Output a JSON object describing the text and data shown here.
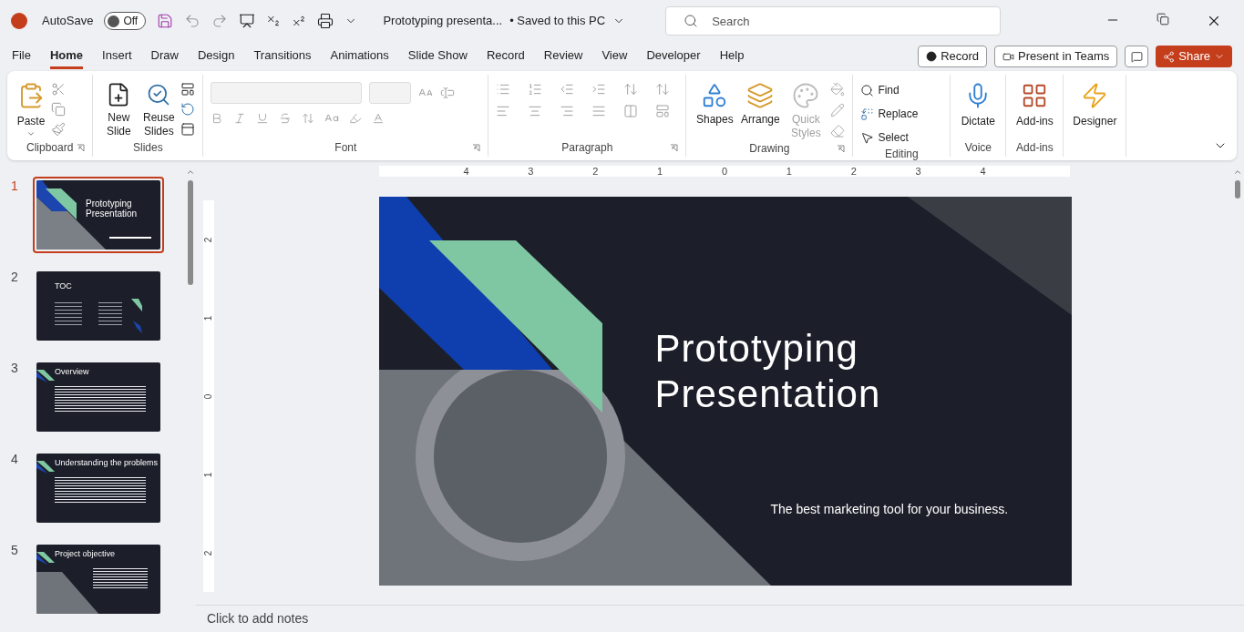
{
  "titlebar": {
    "autosave_label": "AutoSave",
    "autosave_on": false,
    "autosave_state": "Off",
    "file_title": "Prototyping presenta...",
    "save_status": "• Saved to this PC",
    "search_placeholder": "Search"
  },
  "tabs": [
    {
      "label": "File",
      "selected": false
    },
    {
      "label": "Home",
      "selected": true
    },
    {
      "label": "Insert",
      "selected": false
    },
    {
      "label": "Draw",
      "selected": false
    },
    {
      "label": "Design",
      "selected": false
    },
    {
      "label": "Transitions",
      "selected": false
    },
    {
      "label": "Animations",
      "selected": false
    },
    {
      "label": "Slide Show",
      "selected": false
    },
    {
      "label": "Record",
      "selected": false
    },
    {
      "label": "Review",
      "selected": false
    },
    {
      "label": "View",
      "selected": false
    },
    {
      "label": "Developer",
      "selected": false
    },
    {
      "label": "Help",
      "selected": false
    }
  ],
  "actions": {
    "record": "Record",
    "present": "Present in Teams",
    "share": "Share"
  },
  "ribbon": {
    "clipboard": {
      "label": "Clipboard",
      "paste": "Paste"
    },
    "slides": {
      "label": "Slides",
      "new_slide": [
        "New",
        "Slide"
      ],
      "reuse": [
        "Reuse",
        "Slides"
      ]
    },
    "font": {
      "label": "Font",
      "disabled": true
    },
    "paragraph": {
      "label": "Paragraph",
      "disabled": true
    },
    "drawing": {
      "label": "Drawing",
      "buttons": [
        {
          "label": [
            "Shapes"
          ],
          "disabled": false
        },
        {
          "label": [
            "Arrange"
          ],
          "disabled": false
        },
        {
          "label": [
            "Quick",
            "Styles"
          ],
          "disabled": true
        }
      ]
    },
    "editing": {
      "label": "Editing",
      "find": "Find",
      "replace": "Replace",
      "select": "Select"
    },
    "voice": {
      "label": "Voice",
      "dictate": "Dictate"
    },
    "addins": {
      "label": "Add-ins",
      "button": "Add-ins"
    },
    "designer": {
      "button": "Designer"
    }
  },
  "slides": [
    {
      "number": "1",
      "selected": true,
      "kind": "title",
      "title": "Prototyping Presentation"
    },
    {
      "number": "2",
      "selected": false,
      "kind": "toc",
      "title": "TOC"
    },
    {
      "number": "3",
      "selected": false,
      "kind": "text",
      "title": "Overview"
    },
    {
      "number": "4",
      "selected": false,
      "kind": "list",
      "title": "Understanding the problems"
    },
    {
      "number": "5",
      "selected": false,
      "kind": "photo",
      "title": "Project objective"
    }
  ],
  "ruler_h": [
    "4",
    "3",
    "2",
    "1",
    "0",
    "1",
    "2",
    "3",
    "4"
  ],
  "ruler_v": [
    "2",
    "1",
    "0",
    "1",
    "2"
  ],
  "current_slide": {
    "title_lines": [
      "Prototyping",
      "Presentation"
    ],
    "subtitle": "The best marketing tool for your business."
  },
  "notes": {
    "placeholder": "Click to add notes"
  }
}
